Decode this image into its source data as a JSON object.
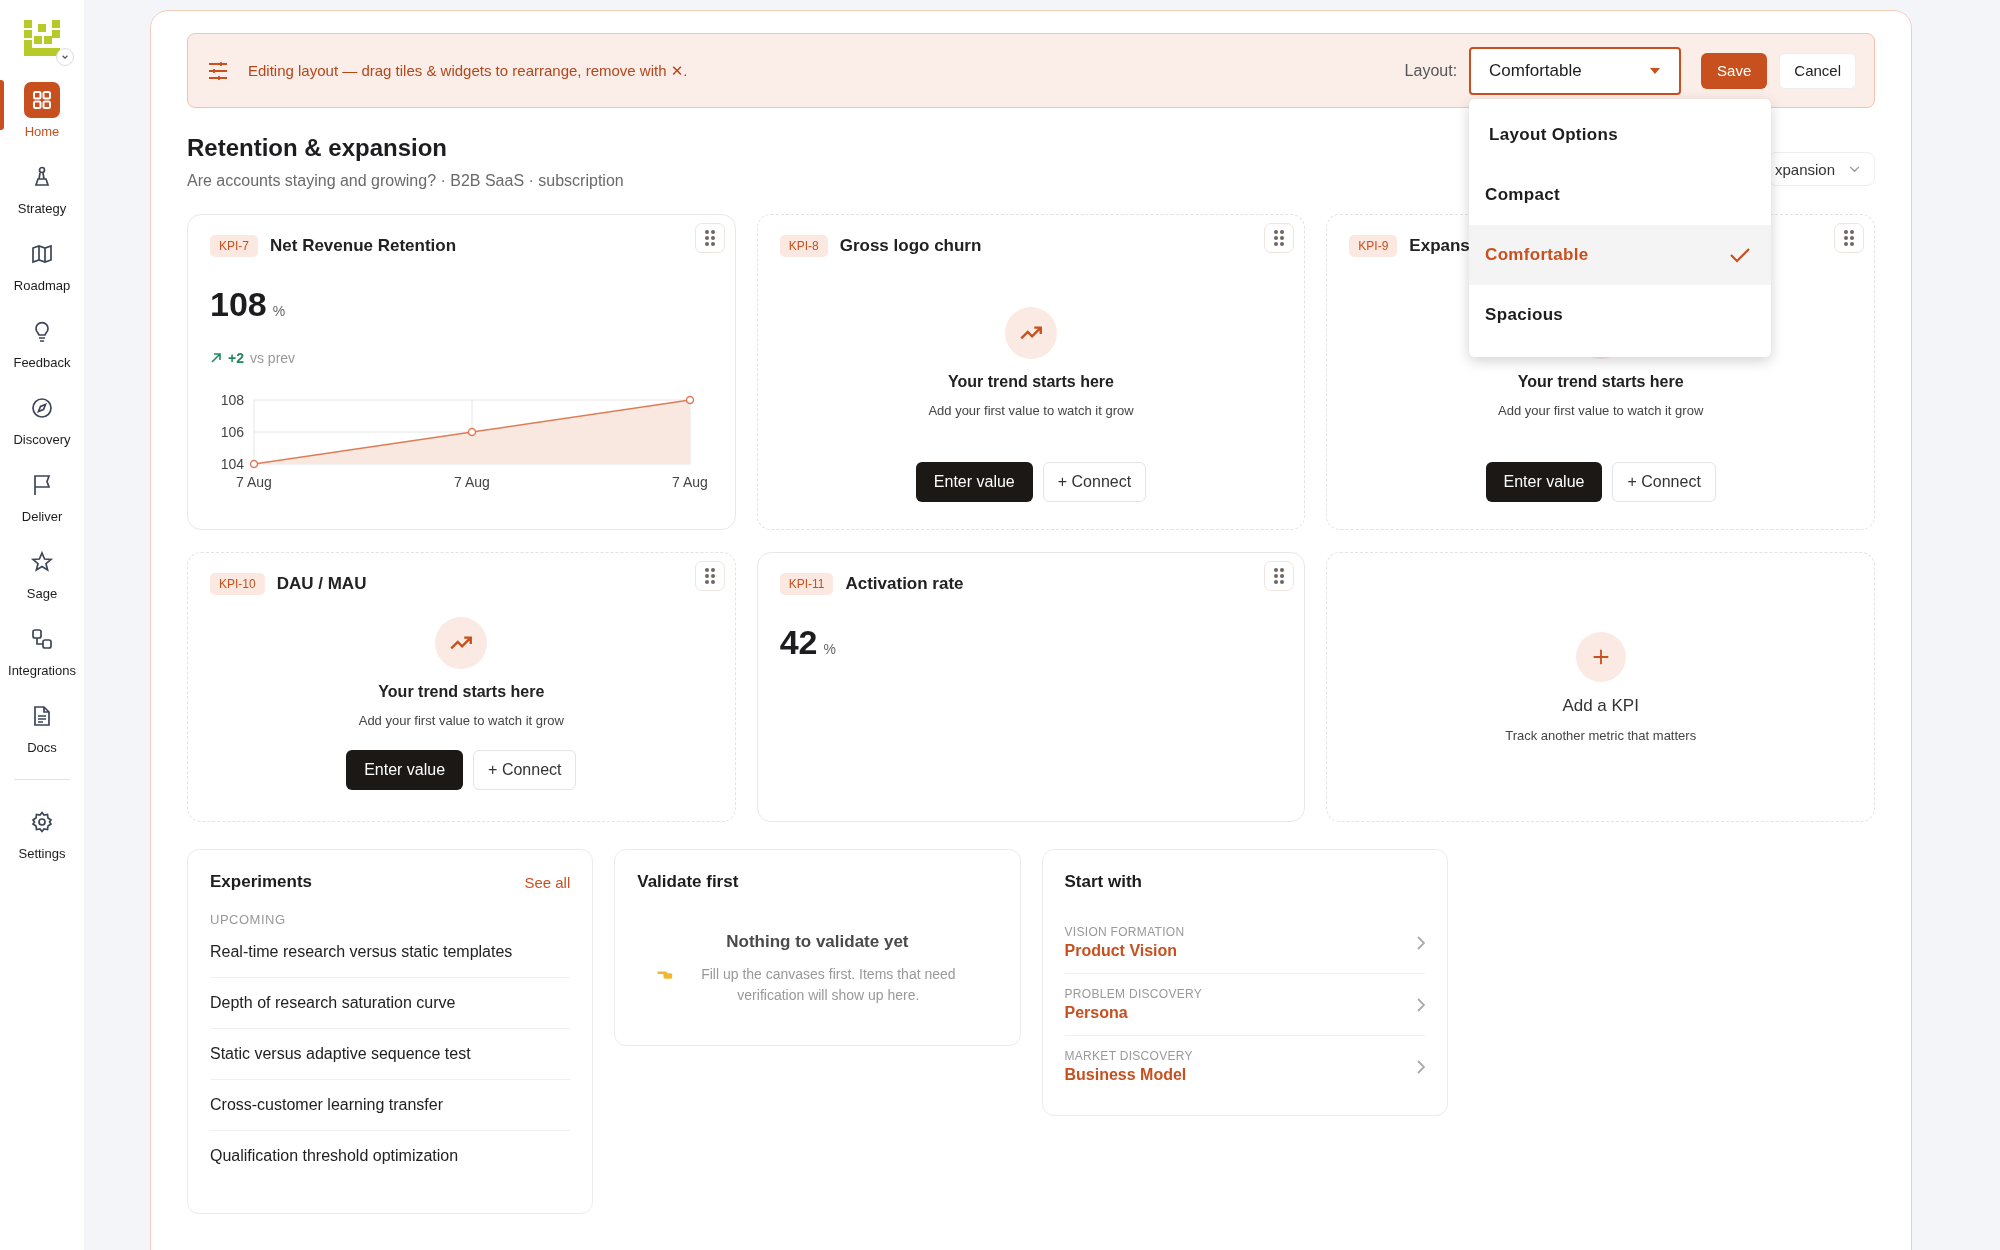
{
  "sidebar": {
    "items": [
      {
        "label": "Home",
        "kind": "grid",
        "selected": true
      },
      {
        "label": "Strategy",
        "kind": "chess",
        "selected": false
      },
      {
        "label": "Roadmap",
        "kind": "map",
        "selected": false
      },
      {
        "label": "Feedback",
        "kind": "bulb",
        "selected": false
      },
      {
        "label": "Discovery",
        "kind": "compass",
        "selected": false
      },
      {
        "label": "Deliver",
        "kind": "flag",
        "selected": false
      },
      {
        "label": "Sage",
        "kind": "star",
        "selected": false
      },
      {
        "label": "Integrations",
        "kind": "nodes",
        "selected": false
      },
      {
        "label": "Docs",
        "kind": "doc",
        "selected": false
      }
    ],
    "footer_items": [
      {
        "label": "Settings",
        "kind": "gear",
        "selected": false
      }
    ]
  },
  "edit_banner": {
    "text": "Editing layout — drag tiles & widgets to rearrange, remove with ✕.",
    "layout_label": "Layout:",
    "layout_select": {
      "value": "Comfortable",
      "expanded": true
    },
    "buttons": [
      "Save",
      "Cancel"
    ]
  },
  "layout_menu": {
    "title": "Layout Options",
    "options": [
      {
        "label": "Compact",
        "selected": false
      },
      {
        "label": "Comfortable",
        "selected": true
      },
      {
        "label": "Spacious",
        "selected": false
      }
    ]
  },
  "header": {
    "title": "Retention & expansion",
    "subtitle": "Are accounts staying and growing? · B2B SaaS · subscription",
    "filter_select": {
      "value": "xpansion"
    }
  },
  "kpis": [
    {
      "kind": "value",
      "id": "KPI-7",
      "title": "Net Revenue Retention",
      "value": "108",
      "unit": "%",
      "delta": "+2",
      "delta_label": "vs prev",
      "chart_data": {
        "type": "line",
        "categories": [
          "7 Aug",
          "7 Aug",
          "7 Aug"
        ],
        "series": [
          {
            "color": "#e07b55",
            "marker": true,
            "values": [
              104,
              106,
              108
            ]
          }
        ],
        "ylim": [
          104,
          108
        ],
        "yticks": [
          104,
          106,
          108
        ]
      }
    },
    {
      "kind": "empty",
      "id": "KPI-8",
      "title": "Gross logo churn",
      "empty_title": "Your trend starts here",
      "empty_text": "Add your first value to watch it grow",
      "buttons": [
        "Enter value",
        "+ Connect"
      ]
    },
    {
      "kind": "empty",
      "id": "KPI-9",
      "title": "Expans",
      "empty_title": "Your trend starts here",
      "empty_text": "Add your first value to watch it grow",
      "buttons": [
        "Enter value",
        "+ Connect"
      ]
    },
    {
      "kind": "empty",
      "id": "KPI-10",
      "title": "DAU / MAU",
      "empty_title": "Your trend starts here",
      "empty_text": "Add your first value to watch it grow",
      "buttons": [
        "Enter value",
        "+ Connect"
      ]
    },
    {
      "kind": "value",
      "id": "KPI-11",
      "title": "Activation rate",
      "value": "42",
      "unit": "%"
    },
    {
      "kind": "add",
      "title": "Add a KPI",
      "text": "Track another metric that matters"
    }
  ],
  "experiments": {
    "title": "Experiments",
    "see_all": "See all",
    "section_label": "UPCOMING",
    "items": [
      "Real-time research versus static templates",
      "Depth of research saturation curve",
      "Static versus adaptive sequence test",
      "Cross-customer learning transfer",
      "Qualification threshold optimization"
    ]
  },
  "validate": {
    "title": "Validate first",
    "empty_title": "Nothing to validate yet",
    "empty_text": "Fill up the canvases first. Items that need verification will show up here."
  },
  "start_with": {
    "title": "Start with",
    "items": [
      {
        "category": "VISION FORMATION",
        "label": "Product Vision"
      },
      {
        "category": "PROBLEM DISCOVERY",
        "label": "Persona"
      },
      {
        "category": "MARKET DISCOVERY",
        "label": "Business Model"
      }
    ]
  }
}
